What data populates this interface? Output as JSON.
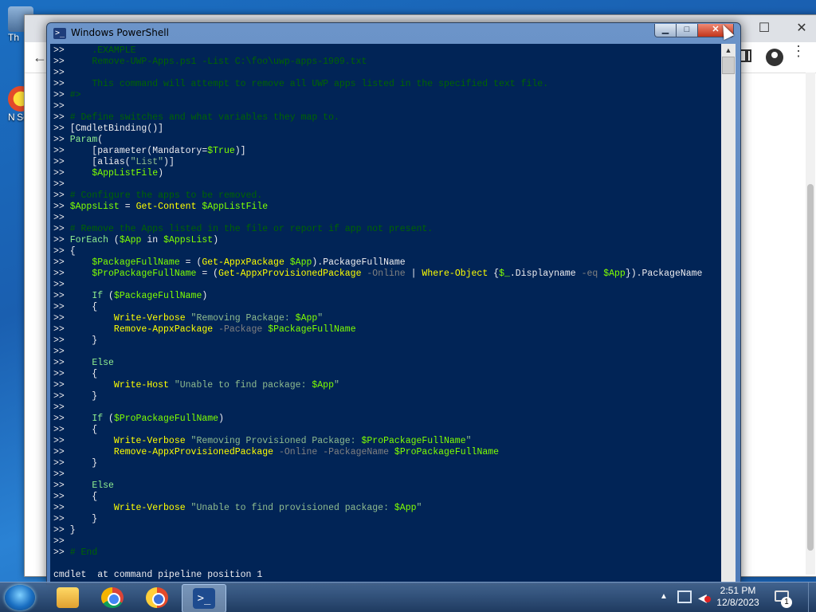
{
  "desktop": {
    "icons": [
      {
        "label": "Th"
      },
      {
        "label": "N Se"
      }
    ]
  },
  "browser": {
    "maximize_glyph": "☐",
    "close_glyph": "✕",
    "back_glyph": "←",
    "menu_glyph": "⋮"
  },
  "powershell": {
    "title": "Windows PowerShell",
    "icon_glyph": ">_",
    "minimize_glyph": "▁",
    "maximize_glyph": "□",
    "close_glyph": "✕",
    "lines": [
      [
        {
          "t": ">>     ",
          "c": "p"
        },
        {
          "t": ".EXAMPLE",
          "c": "c"
        }
      ],
      [
        {
          "t": ">>     ",
          "c": "p"
        },
        {
          "t": "Remove-UWP-Apps.ps1 -List C:\\foo\\uwp-apps-1909.txt",
          "c": "c"
        }
      ],
      [
        {
          "t": ">>",
          "c": "p"
        }
      ],
      [
        {
          "t": ">>     ",
          "c": "p"
        },
        {
          "t": "This command will attempt to remove all UWP apps listed in the specified text file.",
          "c": "c"
        }
      ],
      [
        {
          "t": ">> ",
          "c": "p"
        },
        {
          "t": "#>",
          "c": "c"
        }
      ],
      [
        {
          "t": ">>",
          "c": "p"
        }
      ],
      [
        {
          "t": ">> ",
          "c": "p"
        },
        {
          "t": "# Define switches and what variables they map to.",
          "c": "c"
        }
      ],
      [
        {
          "t": ">> [CmdletBinding()]",
          "c": "p"
        }
      ],
      [
        {
          "t": ">> ",
          "c": "p"
        },
        {
          "t": "Param",
          "c": "k"
        },
        {
          "t": "(",
          "c": "p"
        }
      ],
      [
        {
          "t": ">>     [parameter(Mandatory=",
          "c": "p"
        },
        {
          "t": "$True",
          "c": "v"
        },
        {
          "t": ")]",
          "c": "p"
        }
      ],
      [
        {
          "t": ">>     [alias(",
          "c": "p"
        },
        {
          "t": "\"List\"",
          "c": "s"
        },
        {
          "t": ")]",
          "c": "p"
        }
      ],
      [
        {
          "t": ">>     ",
          "c": "p"
        },
        {
          "t": "$AppListFile",
          "c": "v"
        },
        {
          "t": ")",
          "c": "p"
        }
      ],
      [
        {
          "t": ">>",
          "c": "p"
        }
      ],
      [
        {
          "t": ">> ",
          "c": "p"
        },
        {
          "t": "# Configure the apps to be removed.",
          "c": "c"
        }
      ],
      [
        {
          "t": ">> ",
          "c": "p"
        },
        {
          "t": "$AppsList",
          "c": "v"
        },
        {
          "t": " = ",
          "c": "p"
        },
        {
          "t": "Get-Content",
          "c": "cm"
        },
        {
          "t": " ",
          "c": "p"
        },
        {
          "t": "$AppListFile",
          "c": "v"
        }
      ],
      [
        {
          "t": ">>",
          "c": "p"
        }
      ],
      [
        {
          "t": ">> ",
          "c": "p"
        },
        {
          "t": "# Remove the Apps listed in the file or report if app not present.",
          "c": "c"
        }
      ],
      [
        {
          "t": ">> ",
          "c": "p"
        },
        {
          "t": "ForEach",
          "c": "k"
        },
        {
          "t": " (",
          "c": "p"
        },
        {
          "t": "$App",
          "c": "v"
        },
        {
          "t": " in ",
          "c": "p"
        },
        {
          "t": "$AppsList",
          "c": "v"
        },
        {
          "t": ")",
          "c": "p"
        }
      ],
      [
        {
          "t": ">> {",
          "c": "p"
        }
      ],
      [
        {
          "t": ">>     ",
          "c": "p"
        },
        {
          "t": "$PackageFullName",
          "c": "v"
        },
        {
          "t": " = (",
          "c": "p"
        },
        {
          "t": "Get-AppxPackage",
          "c": "cm"
        },
        {
          "t": " ",
          "c": "p"
        },
        {
          "t": "$App",
          "c": "v"
        },
        {
          "t": ").PackageFullName",
          "c": "p"
        }
      ],
      [
        {
          "t": ">>     ",
          "c": "p"
        },
        {
          "t": "$ProPackageFullName",
          "c": "v"
        },
        {
          "t": " = (",
          "c": "p"
        },
        {
          "t": "Get-AppxProvisionedPackage",
          "c": "cm"
        },
        {
          "t": " ",
          "c": "p"
        },
        {
          "t": "-Online",
          "c": "pa"
        },
        {
          "t": " | ",
          "c": "p"
        },
        {
          "t": "Where-Object",
          "c": "cm"
        },
        {
          "t": " {",
          "c": "p"
        },
        {
          "t": "$_",
          "c": "v"
        },
        {
          "t": ".Displayname ",
          "c": "p"
        },
        {
          "t": "-eq",
          "c": "pa"
        },
        {
          "t": " ",
          "c": "p"
        },
        {
          "t": "$App",
          "c": "v"
        },
        {
          "t": "}).PackageName",
          "c": "p"
        }
      ],
      [
        {
          "t": ">>",
          "c": "p"
        }
      ],
      [
        {
          "t": ">>     ",
          "c": "p"
        },
        {
          "t": "If",
          "c": "k"
        },
        {
          "t": " (",
          "c": "p"
        },
        {
          "t": "$PackageFullName",
          "c": "v"
        },
        {
          "t": ")",
          "c": "p"
        }
      ],
      [
        {
          "t": ">>     {",
          "c": "p"
        }
      ],
      [
        {
          "t": ">>         ",
          "c": "p"
        },
        {
          "t": "Write-Verbose",
          "c": "cm"
        },
        {
          "t": " ",
          "c": "p"
        },
        {
          "t": "\"Removing Package: ",
          "c": "s"
        },
        {
          "t": "$App",
          "c": "v"
        },
        {
          "t": "\"",
          "c": "s"
        }
      ],
      [
        {
          "t": ">>         ",
          "c": "p"
        },
        {
          "t": "Remove-AppxPackage",
          "c": "cm"
        },
        {
          "t": " ",
          "c": "p"
        },
        {
          "t": "-Package",
          "c": "pa"
        },
        {
          "t": " ",
          "c": "p"
        },
        {
          "t": "$PackageFullName",
          "c": "v"
        }
      ],
      [
        {
          "t": ">>     }",
          "c": "p"
        }
      ],
      [
        {
          "t": ">>",
          "c": "p"
        }
      ],
      [
        {
          "t": ">>     ",
          "c": "p"
        },
        {
          "t": "Else",
          "c": "k"
        }
      ],
      [
        {
          "t": ">>     {",
          "c": "p"
        }
      ],
      [
        {
          "t": ">>         ",
          "c": "p"
        },
        {
          "t": "Write-Host",
          "c": "cm"
        },
        {
          "t": " ",
          "c": "p"
        },
        {
          "t": "\"Unable to find package: ",
          "c": "s"
        },
        {
          "t": "$App",
          "c": "v"
        },
        {
          "t": "\"",
          "c": "s"
        }
      ],
      [
        {
          "t": ">>     }",
          "c": "p"
        }
      ],
      [
        {
          "t": ">>",
          "c": "p"
        }
      ],
      [
        {
          "t": ">>     ",
          "c": "p"
        },
        {
          "t": "If",
          "c": "k"
        },
        {
          "t": " (",
          "c": "p"
        },
        {
          "t": "$ProPackageFullName",
          "c": "v"
        },
        {
          "t": ")",
          "c": "p"
        }
      ],
      [
        {
          "t": ">>     {",
          "c": "p"
        }
      ],
      [
        {
          "t": ">>         ",
          "c": "p"
        },
        {
          "t": "Write-Verbose",
          "c": "cm"
        },
        {
          "t": " ",
          "c": "p"
        },
        {
          "t": "\"Removing Provisioned Package: ",
          "c": "s"
        },
        {
          "t": "$ProPackageFullName",
          "c": "v"
        },
        {
          "t": "\"",
          "c": "s"
        }
      ],
      [
        {
          "t": ">>         ",
          "c": "p"
        },
        {
          "t": "Remove-AppxProvisionedPackage",
          "c": "cm"
        },
        {
          "t": " ",
          "c": "p"
        },
        {
          "t": "-Online",
          "c": "pa"
        },
        {
          "t": " ",
          "c": "p"
        },
        {
          "t": "-PackageName",
          "c": "pa"
        },
        {
          "t": " ",
          "c": "p"
        },
        {
          "t": "$ProPackageFullName",
          "c": "v"
        }
      ],
      [
        {
          "t": ">>     }",
          "c": "p"
        }
      ],
      [
        {
          "t": ">>",
          "c": "p"
        }
      ],
      [
        {
          "t": ">>     ",
          "c": "p"
        },
        {
          "t": "Else",
          "c": "k"
        }
      ],
      [
        {
          "t": ">>     {",
          "c": "p"
        }
      ],
      [
        {
          "t": ">>         ",
          "c": "p"
        },
        {
          "t": "Write-Verbose",
          "c": "cm"
        },
        {
          "t": " ",
          "c": "p"
        },
        {
          "t": "\"Unable to find provisioned package: ",
          "c": "s"
        },
        {
          "t": "$App",
          "c": "v"
        },
        {
          "t": "\"",
          "c": "s"
        }
      ],
      [
        {
          "t": ">>     }",
          "c": "p"
        }
      ],
      [
        {
          "t": ">> }",
          "c": "p"
        }
      ],
      [
        {
          "t": ">>",
          "c": "p"
        }
      ],
      [
        {
          "t": ">> ",
          "c": "p"
        },
        {
          "t": "# End",
          "c": "c"
        }
      ],
      [
        {
          "t": "",
          "c": "p"
        }
      ],
      [
        {
          "t": "cmdlet  at command pipeline position 1",
          "c": "p"
        }
      ]
    ],
    "scroll_up_glyph": "▲"
  },
  "taskbar": {
    "apps": [
      {
        "name": "File Explorer"
      },
      {
        "name": "Google Chrome"
      },
      {
        "name": "Google Chrome"
      },
      {
        "name": "Windows PowerShell",
        "active": true
      }
    ],
    "ps_glyph": ">_",
    "tray_up_glyph": "▲",
    "volume_glyph": "◀",
    "clock_time": "2:51 PM",
    "clock_date": "12/8/2023",
    "notification_count": "1"
  }
}
